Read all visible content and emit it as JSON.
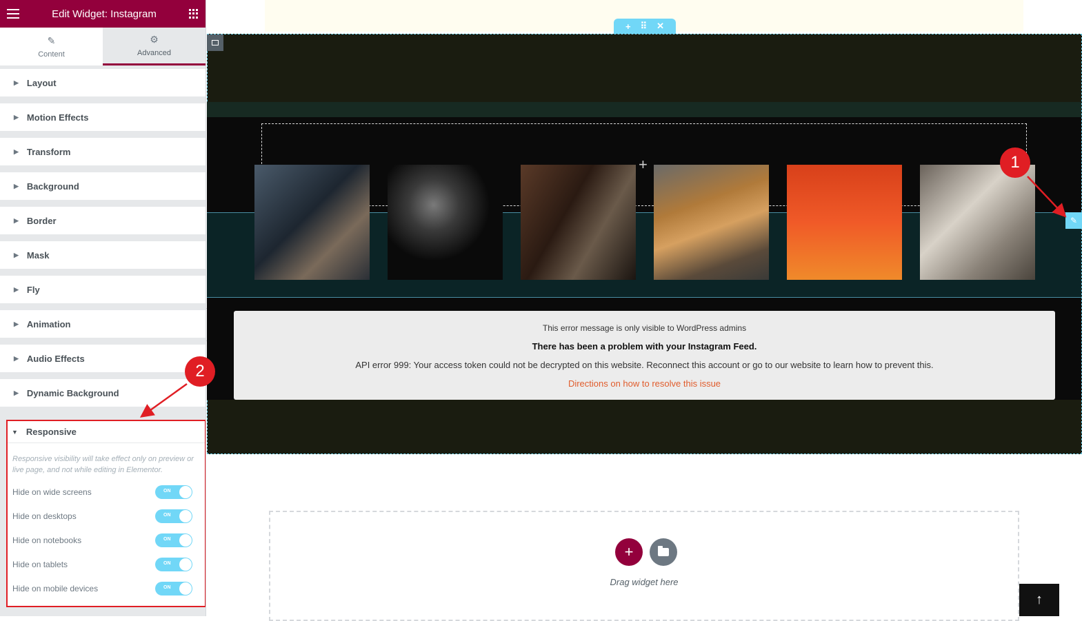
{
  "header": {
    "title": "Edit Widget: Instagram"
  },
  "tabs": [
    {
      "label": "Content",
      "icon": "pencil-icon"
    },
    {
      "label": "Advanced",
      "icon": "gear-icon"
    }
  ],
  "sections": [
    "Layout",
    "Motion Effects",
    "Transform",
    "Background",
    "Border",
    "Mask",
    "Fly",
    "Animation",
    "Audio Effects",
    "Dynamic Background"
  ],
  "responsive": {
    "title": "Responsive",
    "note": "Responsive visibility will take effect only on preview or live page, and not while editing in Elementor.",
    "toggles": [
      {
        "label": "Hide on wide screens",
        "state": "ON"
      },
      {
        "label": "Hide on desktops",
        "state": "ON"
      },
      {
        "label": "Hide on notebooks",
        "state": "ON"
      },
      {
        "label": "Hide on tablets",
        "state": "ON"
      },
      {
        "label": "Hide on mobile devices",
        "state": "ON"
      }
    ]
  },
  "error": {
    "line1": "This error message is only visible to WordPress admins",
    "line2": "There has been a problem with your Instagram Feed.",
    "line3": "API error 999: Your access token could not be decrypted on this website. Reconnect this account or go to our website to learn how to prevent this.",
    "link": "Directions on how to resolve this issue"
  },
  "dropzone": {
    "text": "Drag widget here"
  },
  "annotations": {
    "badge1": "1",
    "badge2": "2"
  },
  "colors": {
    "brand": "#93003c",
    "accent": "#71d7f7",
    "annotation": "#e01e24",
    "link": "#e05c2c"
  }
}
